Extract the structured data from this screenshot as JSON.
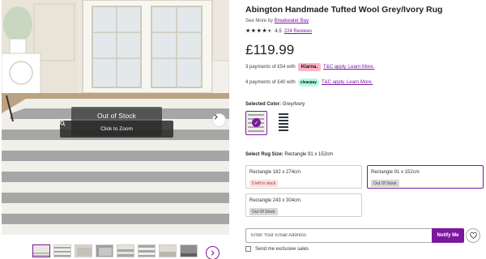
{
  "product": {
    "title": "Abington Handmade Tufted Wool Grey/Ivory Rug",
    "see_more_prefix": "See More by",
    "brand": "Breakwater Bay",
    "rating_value": "4.5",
    "rating_stars": 4.5,
    "reviews_link": "224 Reviews",
    "price": "£119.99"
  },
  "payments": {
    "klarna_text": "3 payments of £54 with",
    "klarna_badge": "Klarna.",
    "klarna_terms": "T&C apply. Learn More.",
    "clearpay_text": "4 payments of £40 with",
    "clearpay_badge": "clearpay",
    "clearpay_terms": "T&C apply. Learn More."
  },
  "color": {
    "label": "Selected Color:",
    "value": "Grey/Ivory"
  },
  "size": {
    "label": "Select Rug Size:",
    "value": "Rectangle 91 x 152cm",
    "options": [
      {
        "name": "Rectangle 182 x 274cm",
        "status": "5 left in stock"
      },
      {
        "name": "Rectangle 91 x 152cm",
        "status": "Out Of Stock"
      },
      {
        "name": "Rectangle 243 x 304cm",
        "status": "Out Of Stock"
      }
    ]
  },
  "gallery": {
    "overlay_title": "Out of Stock",
    "zoom_label": "Click to Zoom",
    "thumbnail_count": 8
  },
  "notify": {
    "email_placeholder": "Enter Your Email Address",
    "button_label": "Notify Me",
    "exclusive_label": "Send me exclusive sales"
  },
  "colors": {
    "accent": "#7b189f",
    "stripe_grey": "#a6a6a6",
    "stripe_ivory": "#f1efe9"
  }
}
